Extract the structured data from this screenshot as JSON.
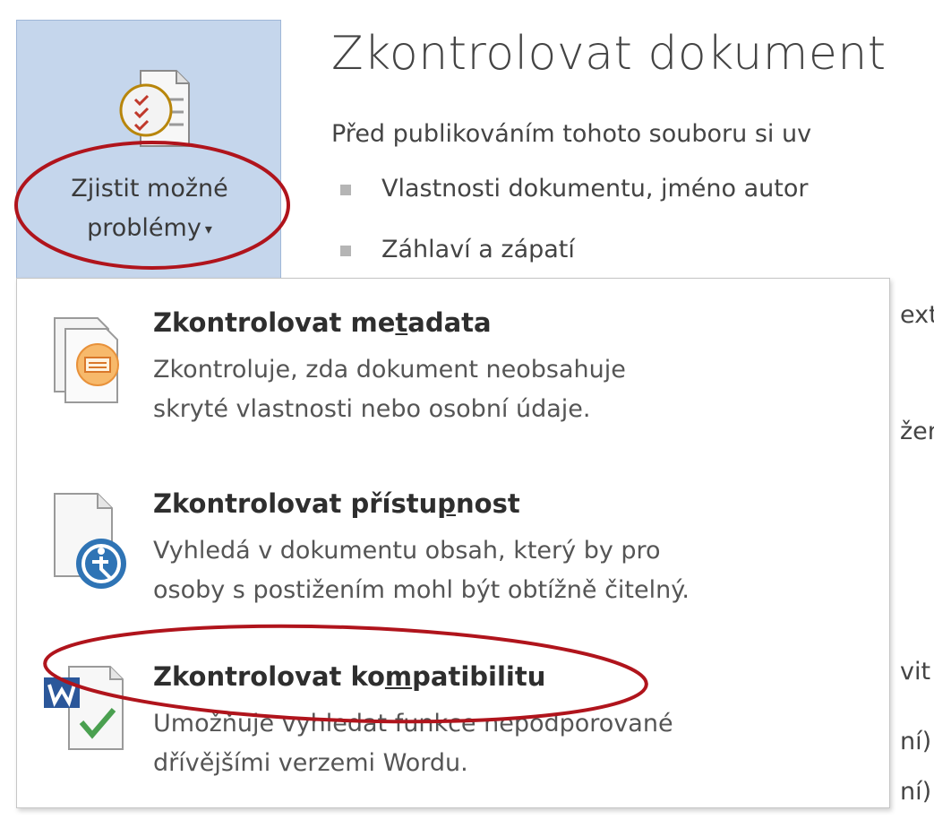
{
  "ribbon": {
    "inspect_button": {
      "line1": "Zjistit možné",
      "line2": "problémy",
      "caret": "▾",
      "icon": "checklist-document-icon"
    }
  },
  "info": {
    "title": "Zkontrolovat dokument",
    "description": "Před publikováním tohoto souboru si uv",
    "bullets": [
      "Vlastnosti dokumentu, jméno autor",
      "Záhlaví a zápatí"
    ],
    "obscured_fragments": [
      "ext",
      "žen",
      "vit",
      "ní)",
      "ní)"
    ]
  },
  "menu": {
    "items": [
      {
        "title_before": "Zkontrolovat me",
        "title_access_key": "t",
        "title_after": "adata",
        "desc_lines": [
          "Zkontroluje, zda dokument neobsahuje",
          "skryté vlastnosti nebo osobní údaje."
        ],
        "icon": "inspect-metadata-icon"
      },
      {
        "title_before": "Zkontrolovat přístu",
        "title_access_key": "p",
        "title_after": "nost",
        "desc_lines": [
          "Vyhledá v dokumentu obsah, který by pro",
          "osoby s postižením mohl být obtížně čitelný."
        ],
        "icon": "accessibility-check-icon"
      },
      {
        "title_before": "Zkontrolovat ko",
        "title_access_key": "m",
        "title_after": "patibilitu",
        "desc_lines": [
          "Umožňuje vyhledat funkce nepodporované",
          "dřívějšími verzemi Wordu."
        ],
        "icon": "word-compatibility-icon"
      }
    ]
  },
  "colors": {
    "button_bg": "#c5d6ec",
    "highlight_red": "#b0141c",
    "accessibility_blue": "#2f74b5",
    "check_green": "#4aa050",
    "word_blue": "#2b579a"
  }
}
